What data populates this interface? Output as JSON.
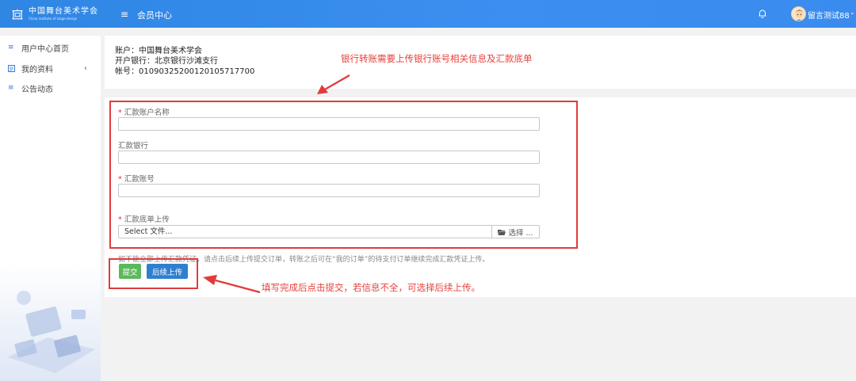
{
  "header": {
    "logo_cn": "中国舞台美术学会",
    "logo_en": "China institute of stage design",
    "menu_icon": "hamburger-icon",
    "module_title": "会员中心",
    "bell_icon": "bell-icon",
    "username": "留言测试88",
    "chevron_icon": "chevron-down-icon"
  },
  "sidebar": {
    "items": [
      {
        "label": "用户中心首页",
        "icon": "list-icon"
      },
      {
        "label": "我的资料",
        "icon": "profile-icon",
        "chevron": "‹"
      },
      {
        "label": "公告动态",
        "icon": "list-icon"
      }
    ]
  },
  "account": {
    "name_line": "账户：中国舞台美术学会",
    "bank_line": "开户银行：北京银行沙滩支行",
    "number_line": "帐号：01090325200120105717700"
  },
  "form": {
    "payer_name_label": "汇款账户名称",
    "payer_name_value": "",
    "bank_label": "汇款银行",
    "bank_value": "",
    "account_label": "汇款账号",
    "account_value": "",
    "upload_label": "汇款底单上传",
    "file_placeholder": "Select 文件...",
    "choose_label": "选择 ...",
    "required_mark": "*",
    "hint": "如不能立即上传汇款凭证，请点击后续上传提交订单，转账之后可在“我的订单”的待支付订单继续完成汇款凭证上传。",
    "submit_label": "提交",
    "later_label": "后续上传"
  },
  "annotations": {
    "top_note": "银行转账需要上传银行账号相关信息及汇款底单",
    "bottom_note": "填写完成后点击提交，若信息不全，可选择后续上传。",
    "color": "#e23b3b"
  },
  "colors": {
    "topbar": "#3a8bee",
    "submit": "#5cb85c",
    "later": "#2f7fd0"
  }
}
